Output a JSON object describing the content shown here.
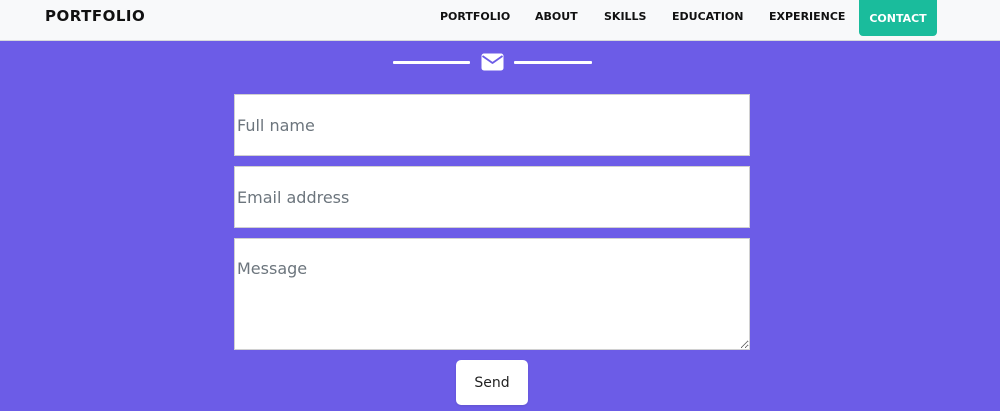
{
  "nav": {
    "brand": "PORTFOLIO",
    "links": [
      {
        "label": "PORTFOLIO"
      },
      {
        "label": "ABOUT"
      },
      {
        "label": "SKILLS"
      },
      {
        "label": "EDUCATION"
      },
      {
        "label": "EXPERIENCE"
      }
    ],
    "contact_label": "CONTACT",
    "contact_color": "#1abc9c"
  },
  "section": {
    "background": "#6c5ce7",
    "divider_icon": "envelope-icon"
  },
  "form": {
    "name_placeholder": "Full name",
    "email_placeholder": "Email address",
    "message_placeholder": "Message",
    "send_label": "Send"
  }
}
